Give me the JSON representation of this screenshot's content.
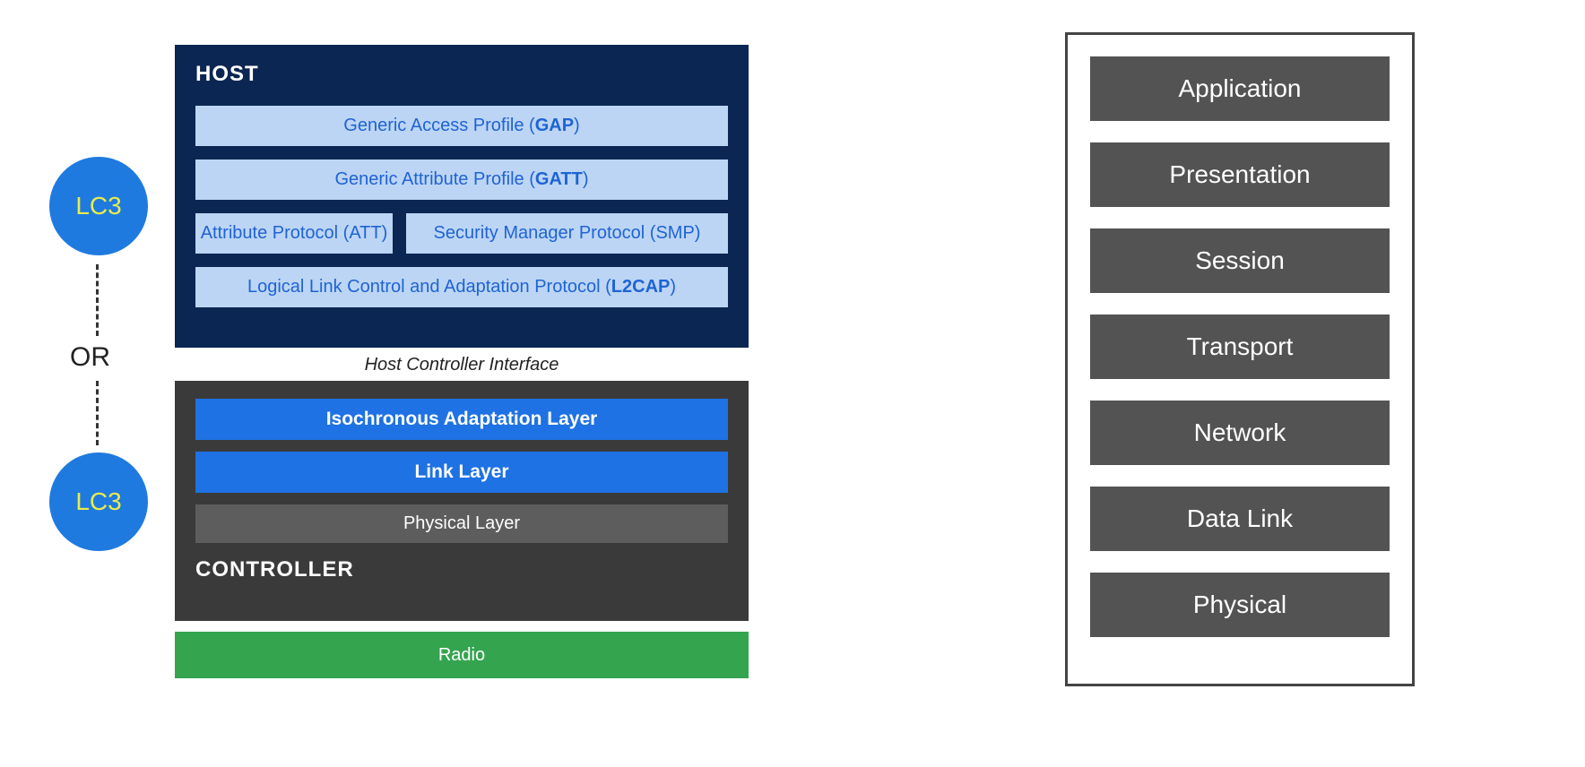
{
  "lc3": {
    "top_label": "LC3",
    "bottom_label": "LC3",
    "or_label": "OR"
  },
  "host": {
    "title": "HOST",
    "gap_text": "Generic Access Profile (",
    "gap_bold": "GAP",
    "gap_close": ")",
    "gatt_text": "Generic Attribute Profile (",
    "gatt_bold": "GATT",
    "gatt_close": ")",
    "att_text": "Attribute Protocol (",
    "att_bold": "ATT",
    "att_close": ")",
    "smp_text": "Security Manager Protocol (",
    "smp_bold": "SMP",
    "smp_close": ")",
    "l2cap_text": "Logical Link Control and Adaptation Protocol (",
    "l2cap_bold": "L2CAP",
    "l2cap_close": ")"
  },
  "hci": {
    "label": "Host Controller Interface"
  },
  "controller": {
    "iso_label": "Isochronous Adaptation Layer",
    "link_label": "Link Layer",
    "phys_label": "Physical Layer",
    "title": "CONTROLLER"
  },
  "radio": {
    "label": "Radio"
  },
  "osi": {
    "layers": {
      "application": "Application",
      "presentation": "Presentation",
      "session": "Session",
      "transport": "Transport",
      "network": "Network",
      "data_link": "Data Link",
      "physical": "Physical"
    }
  },
  "colors": {
    "host_bg": "#0b2652",
    "host_layer_bg": "#bcd5f4",
    "host_layer_text": "#1f63d4",
    "ctrl_bg": "#3a3a3a",
    "ctrl_blue": "#1f72e3",
    "ctrl_grey": "#5d5d5d",
    "radio_bg": "#35a44f",
    "circle_bg": "#1f7ae0",
    "circle_text": "#e8ec4a",
    "osi_layer_bg": "#535353"
  }
}
